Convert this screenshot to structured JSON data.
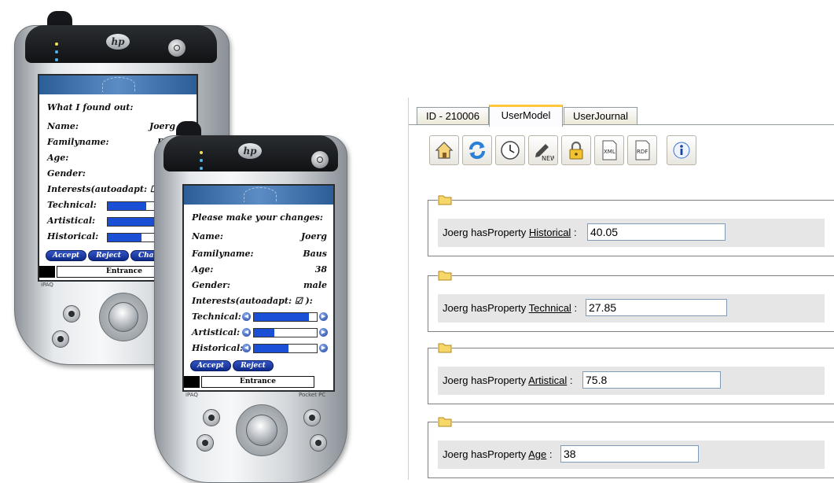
{
  "pda_back": {
    "brand": "hp",
    "heading": "What I found out:",
    "fields": [
      {
        "label": "Name:",
        "value": "Joerg"
      },
      {
        "label": "Familyname:",
        "value": "Baus"
      },
      {
        "label": "Age:",
        "value": ""
      },
      {
        "label": "Gender:",
        "value": ""
      }
    ],
    "interests_label": "Interests(autoadapt: ☐ ):",
    "bars": [
      {
        "label": "Technical:",
        "level": 0.45
      },
      {
        "label": "Artistical:",
        "level": 0.75
      },
      {
        "label": "Historical:",
        "level": 0.4
      }
    ],
    "buttons": [
      "Accept",
      "Reject",
      "Change"
    ],
    "status": "Entrance",
    "model_label": "iPAQ"
  },
  "pda_front": {
    "brand": "hp",
    "heading": "Please make your changes:",
    "fields": [
      {
        "label": "Name:",
        "value": "Joerg"
      },
      {
        "label": "Familyname:",
        "value": "Baus"
      },
      {
        "label": "Age:",
        "value": "38"
      },
      {
        "label": "Gender:",
        "value": "male"
      }
    ],
    "interests_label": "Interests(autoadapt: ☑ ):",
    "bars": [
      {
        "label": "Technical:",
        "level": 0.88
      },
      {
        "label": "Artistical:",
        "level": 0.33
      },
      {
        "label": "Historical:",
        "level": 0.55
      }
    ],
    "buttons": [
      "Accept",
      "Reject"
    ],
    "status": "Entrance",
    "model_label": "iPAQ",
    "os_label": "Pocket PC"
  },
  "panel": {
    "tabs": [
      {
        "label": "ID - 210006",
        "active": false
      },
      {
        "label": "UserModel",
        "active": true
      },
      {
        "label": "UserJournal",
        "active": false
      }
    ],
    "toolbar": [
      {
        "icon": "home-icon"
      },
      {
        "icon": "refresh-icon"
      },
      {
        "icon": "clock-icon"
      },
      {
        "icon": "new-pencil-icon",
        "text": "NEW"
      },
      {
        "icon": "lock-icon"
      },
      {
        "icon": "xml-document-icon",
        "text": "XML"
      },
      {
        "icon": "rdf-document-icon",
        "text": "RDF"
      },
      {
        "icon": "info-icon"
      }
    ],
    "properties": [
      {
        "subject": "Joerg hasProperty",
        "property": "Historical",
        "value": "40.05"
      },
      {
        "subject": "Joerg hasProperty",
        "property": "Technical",
        "value": "27.85"
      },
      {
        "subject": "Joerg hasProperty",
        "property": "Artistical",
        "value": "75.8"
      },
      {
        "subject": "Joerg hasProperty",
        "property": "Age",
        "value": "38"
      }
    ]
  },
  "colors": {
    "bar_fill": "#1b4fd6",
    "pill_button": "#1f3fb0",
    "active_tab_accent": "#ffc83c",
    "group_row_bg": "#e6e6e6",
    "screen_banner": "#2b5d97"
  }
}
